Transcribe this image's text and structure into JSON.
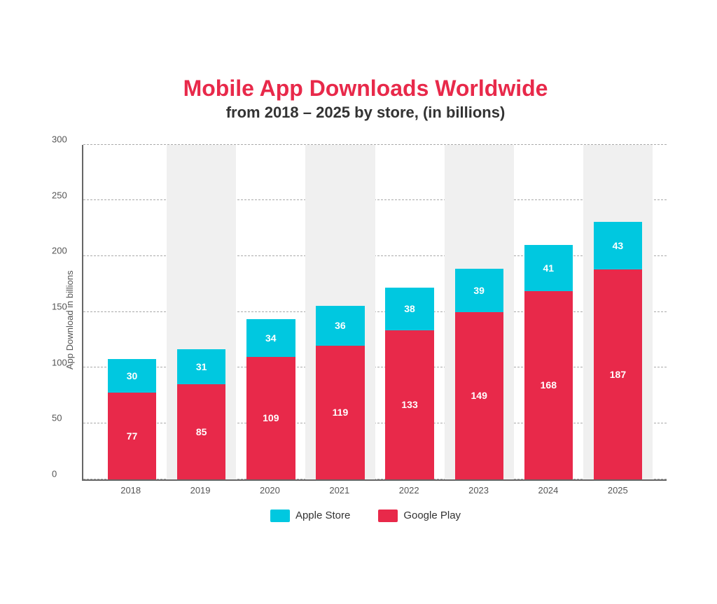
{
  "title": {
    "main": "Mobile App Downloads Worldwide",
    "sub": "from 2018 – 2025 by store, (in billions)"
  },
  "y_axis_label": "App Download in billions",
  "y_ticks": [
    0,
    50,
    100,
    150,
    200,
    250,
    300
  ],
  "max_value": 300,
  "bars": [
    {
      "year": "2018",
      "apple": 30,
      "google": 77,
      "shaded": false
    },
    {
      "year": "2019",
      "apple": 31,
      "google": 85,
      "shaded": true
    },
    {
      "year": "2020",
      "apple": 34,
      "google": 109,
      "shaded": false
    },
    {
      "year": "2021",
      "apple": 36,
      "google": 119,
      "shaded": true
    },
    {
      "year": "2022",
      "apple": 38,
      "google": 133,
      "shaded": false
    },
    {
      "year": "2023",
      "apple": 39,
      "google": 149,
      "shaded": true
    },
    {
      "year": "2024",
      "apple": 41,
      "google": 168,
      "shaded": false
    },
    {
      "year": "2025",
      "apple": 43,
      "google": 187,
      "shaded": true
    }
  ],
  "legend": {
    "apple_label": "Apple Store",
    "google_label": "Google Play"
  }
}
